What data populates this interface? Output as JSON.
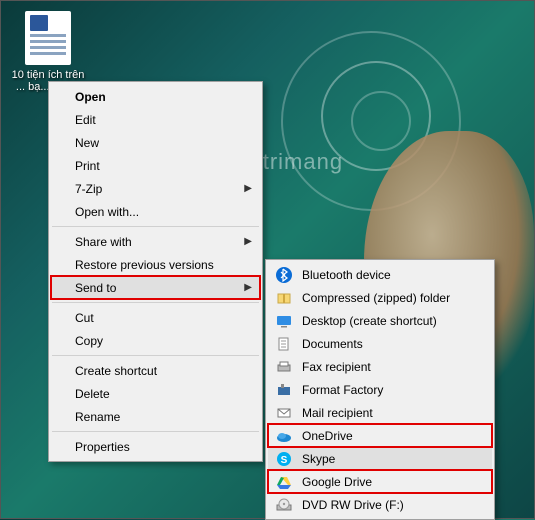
{
  "desktop": {
    "file_label": "10 tiện ích trên ... bạ... nên..."
  },
  "watermark": "uantrimang",
  "context_menu": {
    "open": "Open",
    "edit": "Edit",
    "new": "New",
    "print": "Print",
    "sevenzip": "7-Zip",
    "openwith": "Open with...",
    "sharewith": "Share with",
    "restore": "Restore previous versions",
    "sendto": "Send to",
    "cut": "Cut",
    "copy": "Copy",
    "shortcut": "Create shortcut",
    "delete": "Delete",
    "rename": "Rename",
    "properties": "Properties"
  },
  "sendto_menu": {
    "items": [
      {
        "label": "Bluetooth device"
      },
      {
        "label": "Compressed (zipped) folder"
      },
      {
        "label": "Desktop (create shortcut)"
      },
      {
        "label": "Documents"
      },
      {
        "label": "Fax recipient"
      },
      {
        "label": "Format Factory"
      },
      {
        "label": "Mail recipient"
      },
      {
        "label": "OneDrive"
      },
      {
        "label": "Skype"
      },
      {
        "label": "Google Drive"
      },
      {
        "label": "DVD RW Drive (F:)"
      }
    ]
  }
}
